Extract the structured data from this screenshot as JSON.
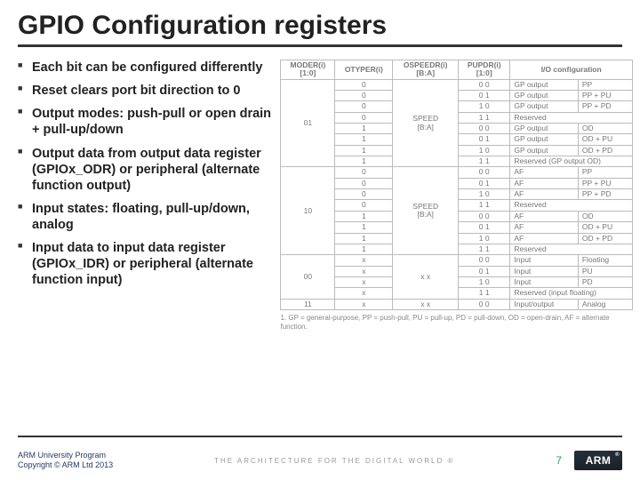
{
  "title": "GPIO Configuration registers",
  "bullets": [
    "Each bit can be configured differently",
    "Reset clears port bit direction to 0",
    "Output modes: push-pull or open drain + pull-up/down",
    "Output data from output data register (GPIOx_ODR) or peripheral (alternate function output)",
    "Input states: floating, pull-up/down, analog",
    "Input data to input data register (GPIOx_IDR) or peripheral (alternate function input)"
  ],
  "table": {
    "headers": [
      "MODER(i)\n[1:0]",
      "OTYPER(i)",
      "OSPEEDR(i)\n[B:A]",
      "PUPDR(i)\n[1:0]",
      "I/O configuration",
      ""
    ],
    "groups": [
      {
        "moder": "01",
        "speed": "SPEED\n[B:A]",
        "rows": [
          {
            "otyper": "0",
            "pupdr": "0 0",
            "cfg": "GP output",
            "io": "PP"
          },
          {
            "otyper": "0",
            "pupdr": "0 1",
            "cfg": "GP output",
            "io": "PP + PU"
          },
          {
            "otyper": "0",
            "pupdr": "1 0",
            "cfg": "GP output",
            "io": "PP + PD"
          },
          {
            "otyper": "0",
            "pupdr": "1 1",
            "cfg": "Reserved",
            "io": ""
          },
          {
            "otyper": "1",
            "pupdr": "0 0",
            "cfg": "GP output",
            "io": "OD"
          },
          {
            "otyper": "1",
            "pupdr": "0 1",
            "cfg": "GP output",
            "io": "OD + PU"
          },
          {
            "otyper": "1",
            "pupdr": "1 0",
            "cfg": "GP output",
            "io": "OD + PD"
          },
          {
            "otyper": "1",
            "pupdr": "1 1",
            "cfg": "Reserved (GP output OD)",
            "io": ""
          }
        ]
      },
      {
        "moder": "10",
        "speed": "SPEED\n[B:A]",
        "rows": [
          {
            "otyper": "0",
            "pupdr": "0 0",
            "cfg": "AF",
            "io": "PP"
          },
          {
            "otyper": "0",
            "pupdr": "0 1",
            "cfg": "AF",
            "io": "PP + PU"
          },
          {
            "otyper": "0",
            "pupdr": "1 0",
            "cfg": "AF",
            "io": "PP + PD"
          },
          {
            "otyper": "0",
            "pupdr": "1 1",
            "cfg": "Reserved",
            "io": ""
          },
          {
            "otyper": "1",
            "pupdr": "0 0",
            "cfg": "AF",
            "io": "OD"
          },
          {
            "otyper": "1",
            "pupdr": "0 1",
            "cfg": "AF",
            "io": "OD + PU"
          },
          {
            "otyper": "1",
            "pupdr": "1 0",
            "cfg": "AF",
            "io": "OD + PD"
          },
          {
            "otyper": "1",
            "pupdr": "1 1",
            "cfg": "Reserved",
            "io": ""
          }
        ]
      },
      {
        "moder": "00",
        "speed": null,
        "rows": [
          {
            "otyper": "x",
            "pupdr": "0 0",
            "cfg": "Input",
            "io": "Floating"
          },
          {
            "otyper": "x",
            "pupdr": "0 1",
            "cfg": "Input",
            "io": "PU"
          },
          {
            "otyper": "x",
            "pupdr": "1 0",
            "cfg": "Input",
            "io": "PD"
          },
          {
            "otyper": "x",
            "pupdr": "1 1",
            "cfg": "Reserved (input floating)",
            "io": ""
          }
        ]
      },
      {
        "moder": "11",
        "speed": null,
        "rows": [
          {
            "otyper": "x",
            "pupdr": "0 0",
            "cfg": "Input/output",
            "io": "Analog"
          }
        ]
      }
    ],
    "footnote": "1. GP = general-purpose, PP = push-pull, PU = pull-up, PD = pull-down, OD = open-drain, AF = alternate function."
  },
  "footer": {
    "program_line1": "ARM University Program",
    "program_line2": "Copyright © ARM Ltd 2013",
    "tagline": "THE ARCHITECTURE FOR THE DIGITAL WORLD ®",
    "page": "7",
    "logo_text": "ARM"
  }
}
